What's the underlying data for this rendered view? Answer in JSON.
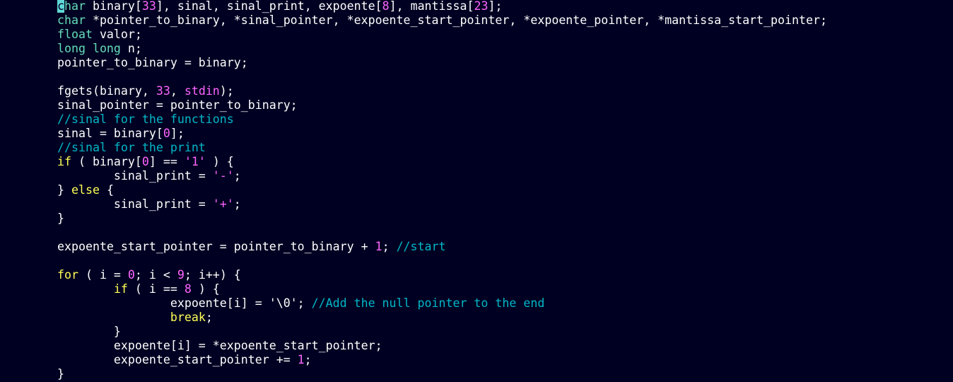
{
  "editor": {
    "background": "#000022",
    "colors": {
      "default": "#ffffff",
      "keyword": "#ffff55",
      "type": "#66ddbb",
      "number": "#ff66ff",
      "string": "#ff66ff",
      "comment": "#00b7c7",
      "cursor": "#5fd7d7"
    },
    "lines": [
      [
        {
          "t": "c",
          "k": "cursor"
        },
        {
          "t": "har",
          "k": "type"
        },
        {
          "t": " binary[",
          "k": "default"
        },
        {
          "t": "33",
          "k": "number"
        },
        {
          "t": "], sinal, sinal_print, expoente[",
          "k": "default"
        },
        {
          "t": "8",
          "k": "number"
        },
        {
          "t": "], mantissa[",
          "k": "default"
        },
        {
          "t": "23",
          "k": "number"
        },
        {
          "t": "];",
          "k": "default"
        }
      ],
      [
        {
          "t": "char",
          "k": "type"
        },
        {
          "t": " *pointer_to_binary, *sinal_pointer, *expoente_start_pointer, *expoente_pointer, *mantissa_start_pointer;",
          "k": "default"
        }
      ],
      [
        {
          "t": "float",
          "k": "type"
        },
        {
          "t": " valor;",
          "k": "default"
        }
      ],
      [
        {
          "t": "long long",
          "k": "type"
        },
        {
          "t": " n;",
          "k": "default"
        }
      ],
      [
        {
          "t": "pointer_to_binary = binary;",
          "k": "default"
        }
      ],
      [],
      [
        {
          "t": "fgets(binary, ",
          "k": "default"
        },
        {
          "t": "33",
          "k": "number"
        },
        {
          "t": ", ",
          "k": "default"
        },
        {
          "t": "stdin",
          "k": "number"
        },
        {
          "t": ");",
          "k": "default"
        }
      ],
      [
        {
          "t": "sinal_pointer = pointer_to_binary;",
          "k": "default"
        }
      ],
      [
        {
          "t": "//sinal for the functions",
          "k": "comment"
        }
      ],
      [
        {
          "t": "sinal = binary[",
          "k": "default"
        },
        {
          "t": "0",
          "k": "number"
        },
        {
          "t": "];",
          "k": "default"
        }
      ],
      [
        {
          "t": "//sinal for the print",
          "k": "comment"
        }
      ],
      [
        {
          "t": "if",
          "k": "keyword"
        },
        {
          "t": " ( binary[",
          "k": "default"
        },
        {
          "t": "0",
          "k": "number"
        },
        {
          "t": "] == ",
          "k": "default"
        },
        {
          "t": "'1'",
          "k": "string"
        },
        {
          "t": " ) {",
          "k": "default"
        }
      ],
      [
        {
          "t": "        sinal_print = ",
          "k": "default"
        },
        {
          "t": "'-'",
          "k": "string"
        },
        {
          "t": ";",
          "k": "default"
        }
      ],
      [
        {
          "t": "} ",
          "k": "default"
        },
        {
          "t": "else",
          "k": "keyword"
        },
        {
          "t": " {",
          "k": "default"
        }
      ],
      [
        {
          "t": "        sinal_print = ",
          "k": "default"
        },
        {
          "t": "'+'",
          "k": "string"
        },
        {
          "t": ";",
          "k": "default"
        }
      ],
      [
        {
          "t": "}",
          "k": "default"
        }
      ],
      [],
      [
        {
          "t": "expoente_start_pointer = pointer_to_binary + ",
          "k": "default"
        },
        {
          "t": "1",
          "k": "number"
        },
        {
          "t": "; ",
          "k": "default"
        },
        {
          "t": "//start",
          "k": "comment"
        }
      ],
      [],
      [
        {
          "t": "for",
          "k": "keyword"
        },
        {
          "t": " ( i = ",
          "k": "default"
        },
        {
          "t": "0",
          "k": "number"
        },
        {
          "t": "; i < ",
          "k": "default"
        },
        {
          "t": "9",
          "k": "number"
        },
        {
          "t": "; i++) {",
          "k": "default"
        }
      ],
      [
        {
          "t": "        ",
          "k": "default"
        },
        {
          "t": "if",
          "k": "keyword"
        },
        {
          "t": " ( i == ",
          "k": "default"
        },
        {
          "t": "8",
          "k": "number"
        },
        {
          "t": " ) {",
          "k": "default"
        }
      ],
      [
        {
          "t": "                expoente[i] = '\\0'; ",
          "k": "default"
        },
        {
          "t": "//Add the null pointer to the end",
          "k": "comment"
        }
      ],
      [
        {
          "t": "                ",
          "k": "default"
        },
        {
          "t": "break",
          "k": "keyword"
        },
        {
          "t": ";",
          "k": "default"
        }
      ],
      [
        {
          "t": "        }",
          "k": "default"
        }
      ],
      [
        {
          "t": "        expoente[i] = *expoente_start_pointer;",
          "k": "default"
        }
      ],
      [
        {
          "t": "        expoente_start_pointer += ",
          "k": "default"
        },
        {
          "t": "1",
          "k": "number"
        },
        {
          "t": ";",
          "k": "default"
        }
      ],
      [
        {
          "t": "}",
          "k": "default"
        }
      ]
    ]
  }
}
